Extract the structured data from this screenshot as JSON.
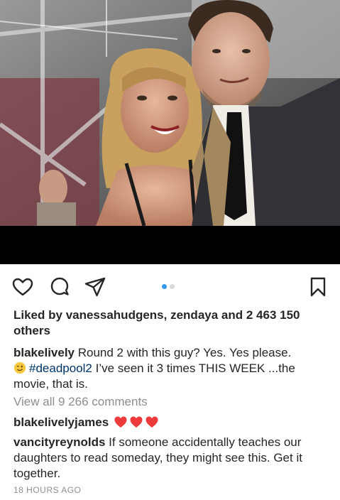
{
  "post": {
    "liked_by_prefix": "Liked by ",
    "liked_user_1": "vanessahudgens",
    "liked_sep": ", ",
    "liked_user_2": "zendaya",
    "liked_and": " and ",
    "liked_count": "2 463 150 others",
    "caption_user": "blakelively",
    "caption_part1": " Round 2 with this guy? Yes. Yes please.",
    "caption_hashtag": "#deadpool2",
    "caption_part2": " I’ve seen it 3 times THIS WEEK ...the movie, that is.",
    "view_all_comments": "View all 9 266 comments",
    "timestamp": "18 HOURS AGO"
  },
  "comments": [
    {
      "user": "blakelivelyjames",
      "text": "",
      "hearts": 3
    },
    {
      "user": "vancityreynolds",
      "text": " If someone accidentally teaches our daughters to read someday, they might see this. Get it together."
    }
  ],
  "carousel": {
    "count": 2,
    "active": 0,
    "active_color": "#3897f0",
    "inactive_color": "#dbdbdb"
  },
  "icons": {
    "like": "heart-outline-icon",
    "comment": "comment-bubble-icon",
    "share": "paper-plane-icon",
    "save": "bookmark-icon",
    "emoji": "winking-face-emoji",
    "reaction": "red-heart-emoji"
  },
  "colors": {
    "hashtag": "#003569",
    "muted": "#8e8e8e",
    "heart": "#ed3b3b"
  }
}
